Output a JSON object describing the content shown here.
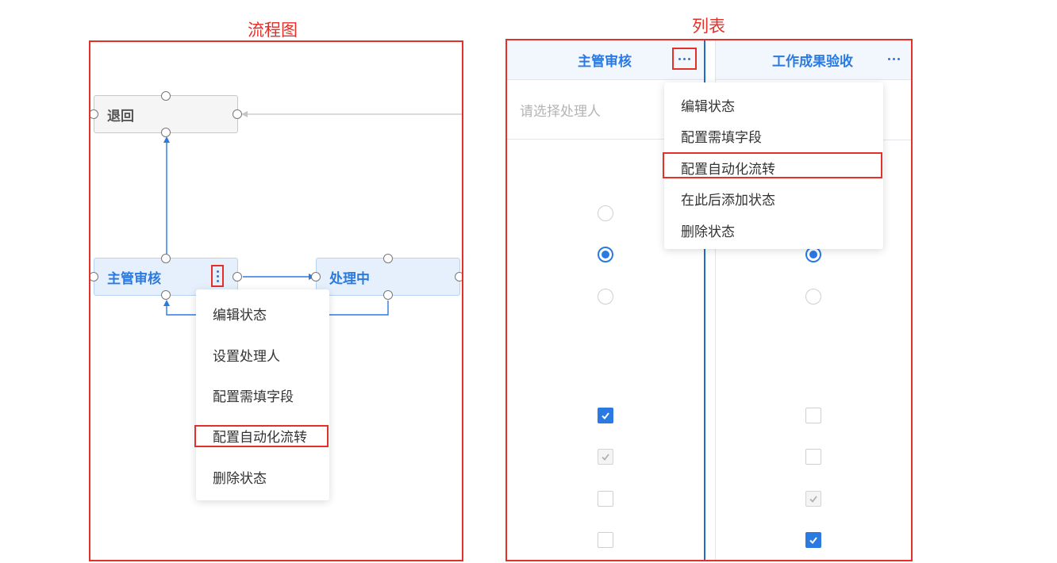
{
  "flowchart_panel": {
    "caption": "流程图",
    "nodes": {
      "return": "退回",
      "supervisor_review": "主管审核",
      "processing": "处理中"
    },
    "context_menu": {
      "items": [
        "编辑状态",
        "设置处理人",
        "配置需填字段",
        "配置自动化流转",
        "删除状态"
      ],
      "highlighted_item": "配置自动化流转"
    }
  },
  "list_panel": {
    "caption": "列表",
    "columns": [
      "主管审核",
      "工作成果验收"
    ],
    "assignee_placeholder": "请选择处理人",
    "context_menu": {
      "items": [
        "编辑状态",
        "配置需填字段",
        "配置自动化流转",
        "在此后添加状态",
        "删除状态"
      ],
      "highlighted_item": "配置自动化流转"
    },
    "radio_rows": [
      {
        "col1": "unselected",
        "col2": "hidden"
      },
      {
        "col1": "selected",
        "col2": "selected"
      },
      {
        "col1": "unselected",
        "col2": "unselected"
      }
    ],
    "checkbox_rows": [
      {
        "col1": "checked",
        "col2": "unchecked"
      },
      {
        "col1": "checked-disabled",
        "col2": "unchecked"
      },
      {
        "col1": "unchecked",
        "col2": "checked-disabled"
      },
      {
        "col1": "unchecked",
        "col2": "checked"
      }
    ]
  },
  "colors": {
    "accent": "#2a7ae2",
    "highlight_frame": "#e5302a",
    "node_blue_bg": "#e6f0fc",
    "node_gray_bg": "#f5f5f5"
  },
  "icons": [
    "vertical-more-icon",
    "horizontal-more-icon",
    "arrow-icon",
    "checkmark-icon"
  ]
}
